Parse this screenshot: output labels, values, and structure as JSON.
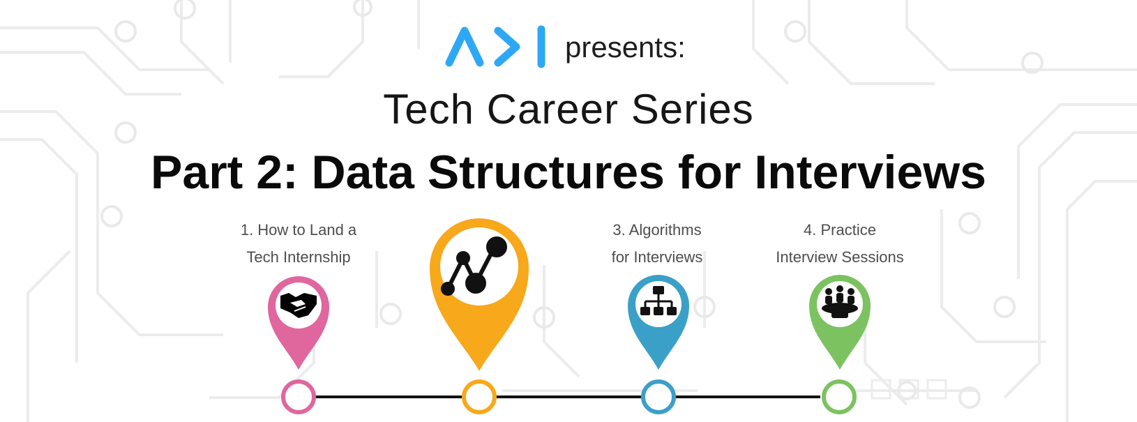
{
  "header": {
    "logo_text": "A>I",
    "presents": "presents:",
    "series_title": "Tech Career Series",
    "part_title": "Part 2: Data Structures for Interviews"
  },
  "timeline": {
    "steps": [
      {
        "line1": "1. How to Land a",
        "line2": "Tech Internship",
        "color": "#e0669e",
        "icon": "handshake-icon"
      },
      {
        "line1": "",
        "line2": "",
        "color": "#f7a81b",
        "icon": "data-graph-icon"
      },
      {
        "line1": "3. Algorithms",
        "line2": "for Interviews",
        "color": "#3aa0c8",
        "icon": "hierarchy-icon"
      },
      {
        "line1": "4. Practice",
        "line2": "Interview Sessions",
        "color": "#7cc261",
        "icon": "meeting-icon"
      }
    ]
  },
  "colors": {
    "logo_blue": "#2ea8f4",
    "line": "#111111",
    "circuit": "#ececec"
  }
}
